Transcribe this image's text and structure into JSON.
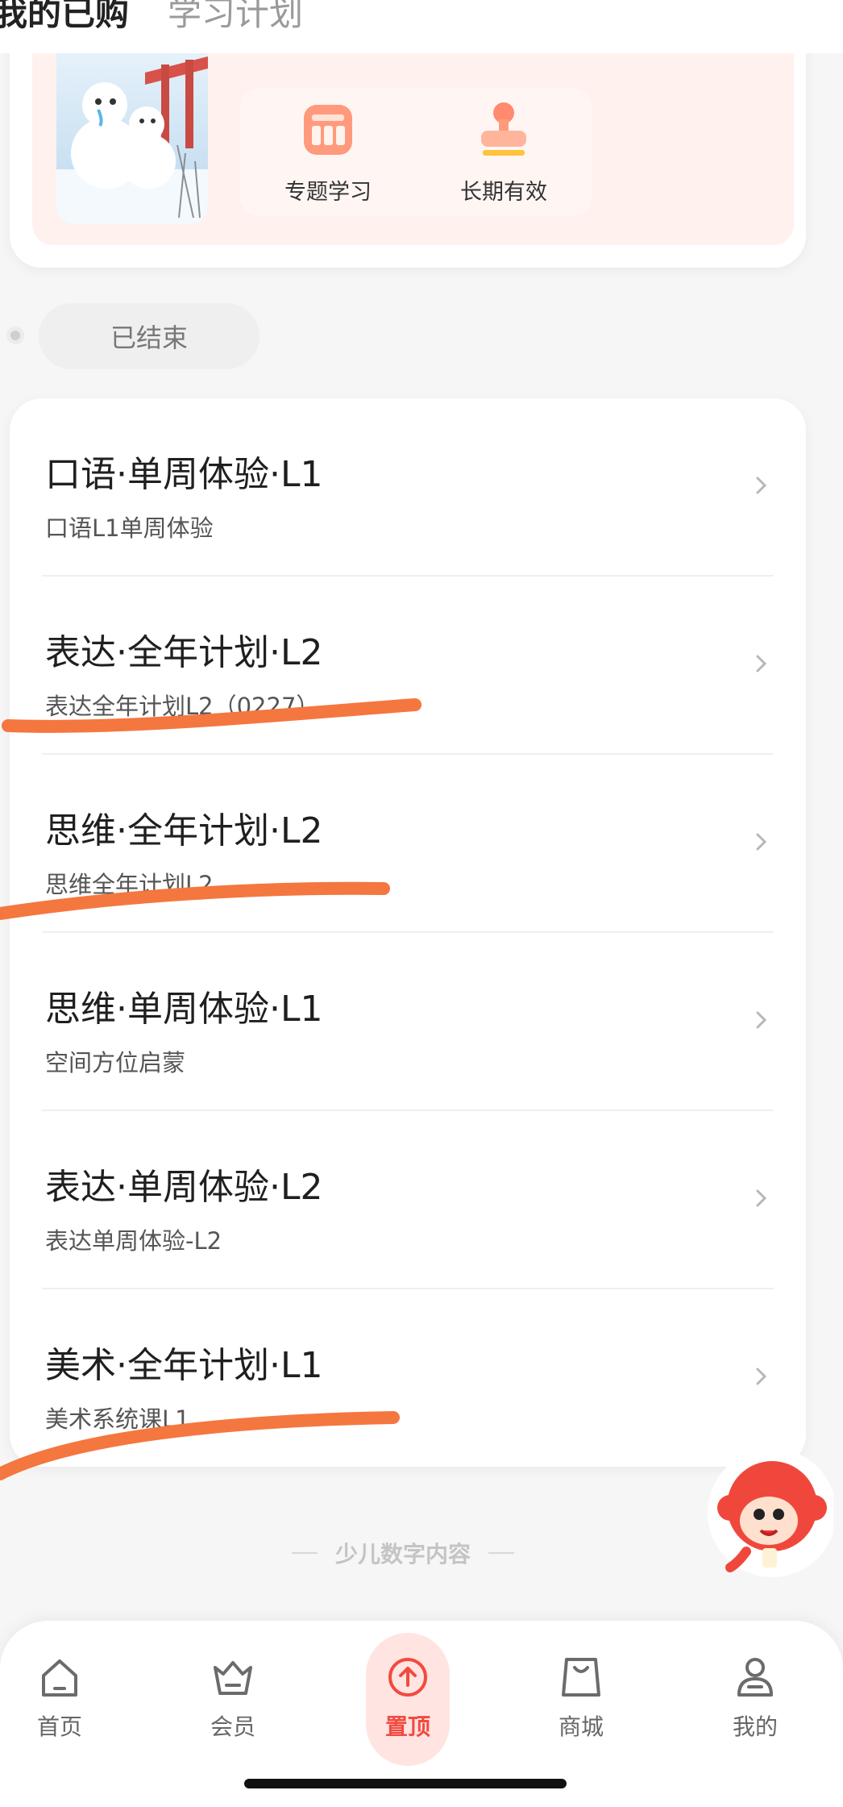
{
  "header": {
    "tabs": [
      {
        "label": "我的已购",
        "active": true
      },
      {
        "label": "学习计划",
        "active": false
      }
    ]
  },
  "promo": {
    "features": [
      {
        "label": "专题学习",
        "icon": "calendar-grid-icon"
      },
      {
        "label": "长期有效",
        "icon": "stamp-icon"
      }
    ]
  },
  "filter": {
    "label": "已结束"
  },
  "courses": [
    {
      "title": "口语·单周体验·L1",
      "subtitle": "口语L1单周体验"
    },
    {
      "title": "表达·全年计划·L2",
      "subtitle": "表达全年计划L2（0227）"
    },
    {
      "title": "思维·全年计划·L2",
      "subtitle": "思维全年计划L2"
    },
    {
      "title": "思维·单周体验·L1",
      "subtitle": "空间方位启蒙"
    },
    {
      "title": "表达·单周体验·L2",
      "subtitle": "表达单周体验-L2"
    },
    {
      "title": "美术·全年计划·L1",
      "subtitle": "美术系统课L1"
    }
  ],
  "tagline": "少儿数字内容",
  "nav": {
    "items": [
      {
        "label": "首页",
        "icon": "home-icon"
      },
      {
        "label": "会员",
        "icon": "crown-basket-icon"
      },
      {
        "label": "置顶",
        "icon": "arrow-up-circle-icon",
        "active": true
      },
      {
        "label": "商城",
        "icon": "shopping-bag-icon"
      },
      {
        "label": "我的",
        "icon": "user-icon"
      }
    ]
  },
  "colors": {
    "accent": "#f24a3f",
    "annotation_stroke": "#f4773f",
    "promo_bg": "#fff1ee"
  }
}
